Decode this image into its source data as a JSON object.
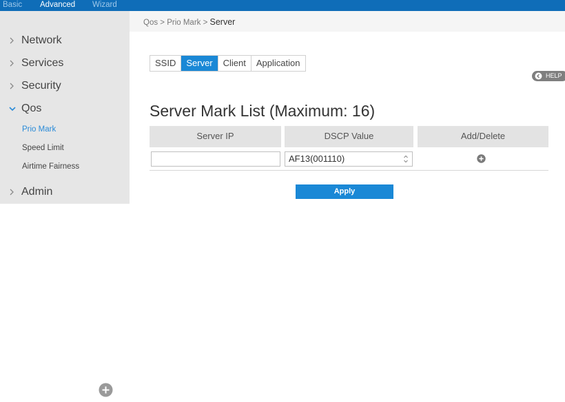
{
  "topbar": {
    "tabs": [
      {
        "label": "Basic",
        "active": false
      },
      {
        "label": "Advanced",
        "active": true
      },
      {
        "label": "Wizard",
        "active": false
      }
    ]
  },
  "sidebar": {
    "items": [
      {
        "label": "Network",
        "expanded": false
      },
      {
        "label": "Services",
        "expanded": false
      },
      {
        "label": "Security",
        "expanded": false
      },
      {
        "label": "Qos",
        "expanded": true
      },
      {
        "label": "Admin",
        "expanded": false
      }
    ],
    "qos_sub": [
      {
        "label": "Prio Mark",
        "active": true
      },
      {
        "label": "Speed Limit",
        "active": false
      },
      {
        "label": "Airtime Fairness",
        "active": false
      }
    ]
  },
  "breadcrumb": {
    "path": "Qos > Prio Mark > ",
    "current": "Server"
  },
  "subtabs": [
    {
      "label": "SSID",
      "active": false
    },
    {
      "label": "Server",
      "active": true
    },
    {
      "label": "Client",
      "active": false
    },
    {
      "label": "Application",
      "active": false
    }
  ],
  "help": {
    "label": "HELP"
  },
  "heading": "Server Mark List (Maximum: 16)",
  "table": {
    "columns": [
      "Server IP",
      "DSCP Value",
      "Add/Delete"
    ],
    "row": {
      "server_ip": "",
      "dscp_value": "AF13(001110)"
    }
  },
  "apply_label": "Apply",
  "colors": {
    "topbar": "#0f6db8",
    "accent": "#1a88d6",
    "sidebar_bg": "#e6e6e6",
    "header_cell_bg": "#e3e3e3"
  }
}
